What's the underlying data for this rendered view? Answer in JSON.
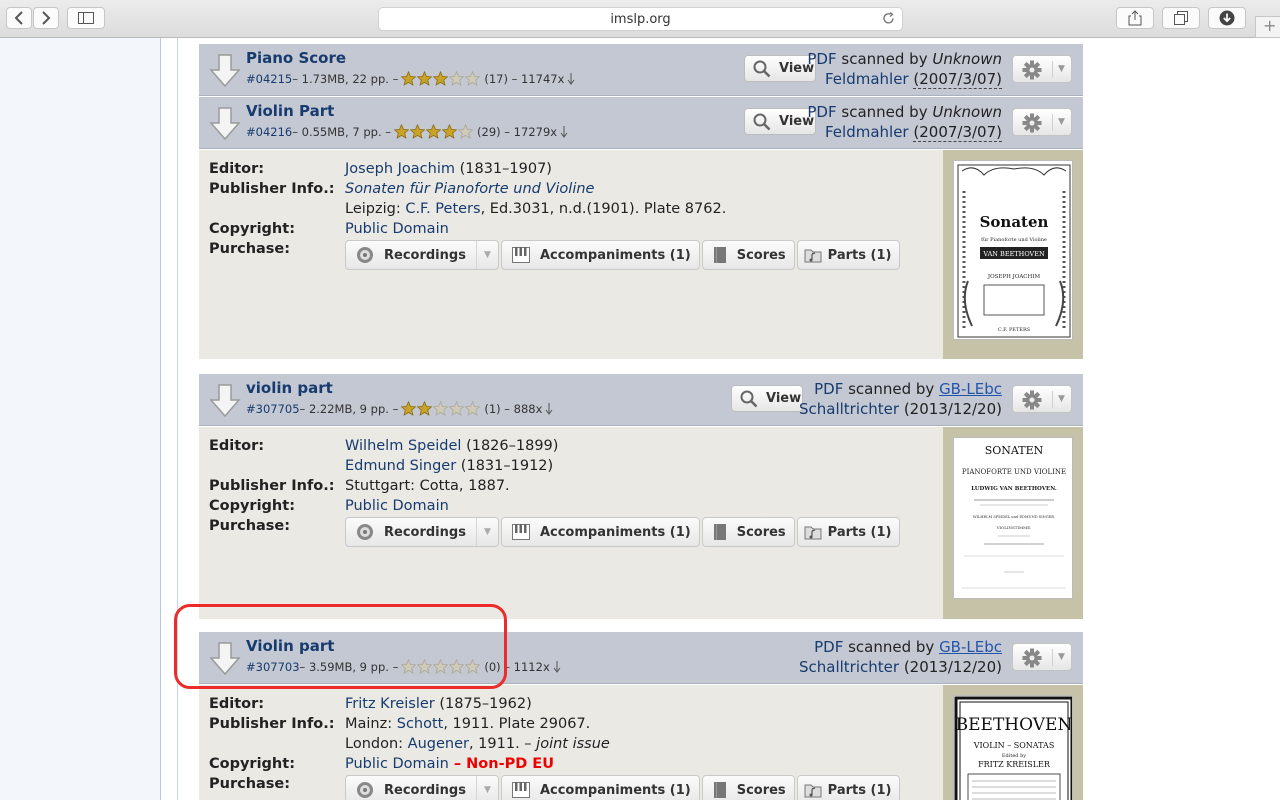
{
  "browser": {
    "url": "imslp.org",
    "new_tab": "+"
  },
  "files": [
    {
      "title": "Piano Score",
      "id": "#04215",
      "meta": " – 1.73MB, 22 pp. – ",
      "rating": 3,
      "votes": "(17) – 11747x",
      "view_label": "View",
      "format": "PDF",
      "scanned_by": " scanned by ",
      "scanner": "Unknown",
      "scanner2": "Feldmahler",
      "date": "(2007/3/07)"
    },
    {
      "title": "Violin Part",
      "id": "#04216",
      "meta": " – 0.55MB, 7 pp. – ",
      "rating": 4,
      "votes": "(29) – 17279x",
      "view_label": "View",
      "format": "PDF",
      "scanned_by": " scanned by ",
      "scanner": "Unknown",
      "scanner2": "Feldmahler",
      "date": "(2007/3/07)"
    },
    {
      "title": "violin part",
      "id": "#307705",
      "meta": " – 2.22MB, 9 pp. – ",
      "rating": 2,
      "votes": "(1) – 888x",
      "view_label": "View",
      "format": "PDF",
      "scanned_by": " scanned by ",
      "scanner": "GB-LEbc",
      "scanner2": "Schalltrichter",
      "date": "(2013/12/20)"
    },
    {
      "title": "Violin part",
      "id": "#307703",
      "meta": " – 3.59MB, 9 pp. – ",
      "rating": 0,
      "votes": "(0) – 1112x",
      "format": "PDF",
      "scanned_by": " scanned by ",
      "scanner": "GB-LEbc",
      "scanner2": "Schalltrichter",
      "date": "(2013/12/20)"
    }
  ],
  "labels": {
    "editor": "Editor:",
    "publisher": "Publisher Info.:",
    "copyright": "Copyright:",
    "purchase": "Purchase:"
  },
  "editions": [
    {
      "editor": "Joseph Joachim",
      "editor_years": " (1831–1907)",
      "pub_title": "Sonaten für Pianoforte und Violine",
      "pub_line_a": "Leipzig: ",
      "pub_link": "C.F. Peters",
      "pub_line_b": ", Ed.3031, n.d.(1901). Plate 8762.",
      "copyright": "Public Domain"
    },
    {
      "editor": "Wilhelm Speidel",
      "editor_years": " (1826–1899)",
      "editor2": "Edmund Singer",
      "editor2_years": " (1831–1912)",
      "pub_line": "Stuttgart: Cotta, 1887.",
      "copyright": "Public Domain"
    },
    {
      "editor": "Fritz Kreisler",
      "editor_years": " (1875–1962)",
      "pub_line_a": "Mainz: ",
      "pub_link": "Schott",
      "pub_line_b": ", 1911. Plate 29067.",
      "pub2_a": "London: ",
      "pub2_link": "Augener",
      "pub2_b": ", 1911. – ",
      "pub2_em": "joint issue",
      "copyright": "Public Domain",
      "copyright_sep": " – ",
      "copyright_extra": "Non-PD EU"
    }
  ],
  "purchase_buttons": {
    "recordings": "Recordings",
    "accompaniments": "Accompaniments (1)",
    "scores": "Scores",
    "parts": "Parts (1)"
  },
  "thumbnails": [
    {
      "title": "Sonaten",
      "sub": "für Pianoforte und Violine",
      "composer": "VAN BEETHOVEN",
      "editor": "JOSEPH JOACHIM",
      "publisher": "C.F. PETERS"
    },
    {
      "title": "SONATEN",
      "sub": "PIANOFORTE UND VIOLINE",
      "composer": "LUDWIG VAN BEETHOVEN.",
      "editor": "WILHELM SPEIDEL und EDMUND SINGER.",
      "part": "VIOLINSTIMME."
    },
    {
      "title": "BEETHOVEN",
      "sub": "VIOLIN – SONATAS",
      "editor_line": "Edited by",
      "editor": "FRITZ KREISLER"
    }
  ],
  "colors": {
    "highlight": "#ec2b2b",
    "link": "#173b6e",
    "star": "#c9a227"
  }
}
